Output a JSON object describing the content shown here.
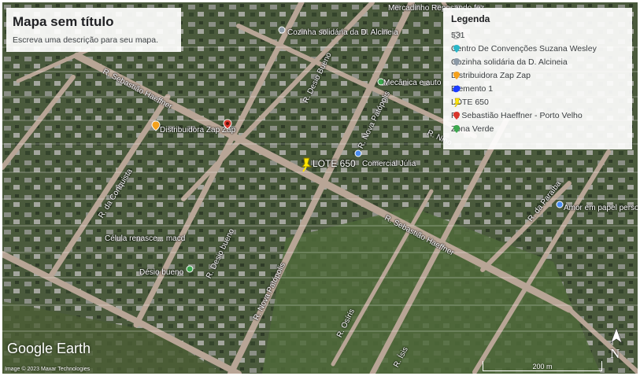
{
  "map": {
    "title": "Mapa sem título",
    "description": "Escreva uma descrição para seu mapa."
  },
  "legend": {
    "title": "Legenda",
    "items": [
      {
        "label": "531",
        "icon": "polygon-outline-icon",
        "color": "#dddddd"
      },
      {
        "label": "Centro De Convenções Suzana Wesley",
        "icon": "cyan-pin-icon",
        "color": "#29b6c8"
      },
      {
        "label": "Cozinha solidária da D. Alcineia",
        "icon": "gray-pin-icon",
        "color": "#8c9aa6"
      },
      {
        "label": "Distribuidora Zap Zap",
        "icon": "orange-pin-icon",
        "color": "#f4a11c"
      },
      {
        "label": "Elemento 1",
        "icon": "blue-polygon-icon",
        "color": "#1a3cff"
      },
      {
        "label": "LOTE 650",
        "icon": "yellow-pushpin-icon",
        "color": "#ffe600"
      },
      {
        "label": "R. Sebastião Haeffner - Porto Velho",
        "icon": "red-pin-icon",
        "color": "#d9362b"
      },
      {
        "label": "Zona Verde",
        "icon": "green-pin-icon",
        "color": "#3da84f"
      }
    ]
  },
  "places": {
    "mercadinho": "Mercadinho Reposando fez",
    "cozinha": "Cozinha solidária da D. Alcineia",
    "mecanica": "Mecânica e auto",
    "distribuidora": "Distribuidora Zap Zap",
    "lote": "LOTE 650",
    "comercial": "Comercial Júlia",
    "celula": "Célula renasce... macd",
    "desio": "Désio bueno",
    "amor": "Amor em papel personalizado"
  },
  "streets": {
    "haeffner_a": "R. Sebastião Haeffner",
    "haeffner_b": "R. Sebastião Haeffner",
    "desio1": "R. Desio Bueno",
    "desio2": "R. Desio bueno",
    "nova1": "R. Nova Patópolis",
    "nova2": "R. Nova Patópolis",
    "conquista": "R. da Conquista",
    "osiris": "R. Osíris",
    "isis": "R. Ísis",
    "paraiba": "R. da Paraíba",
    "nino": "R. Nino"
  },
  "footer": {
    "brand": "Google Earth",
    "copyright": "Image © 2023 Maxar Technologies",
    "scale": "200 m",
    "north": "N"
  }
}
